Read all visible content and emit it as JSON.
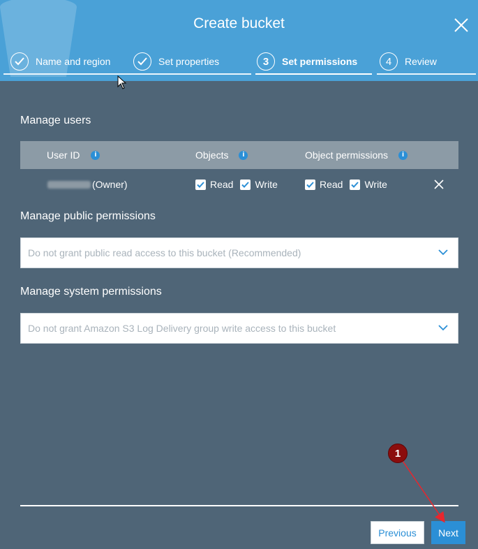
{
  "dialog": {
    "title": "Create bucket",
    "steps": [
      {
        "number": "1",
        "label": "Name and region",
        "state": "completed"
      },
      {
        "number": "2",
        "label": "Set properties",
        "state": "completed"
      },
      {
        "number": "3",
        "label": "Set permissions",
        "state": "active"
      },
      {
        "number": "4",
        "label": "Review",
        "state": "pending"
      }
    ]
  },
  "manage_users": {
    "title": "Manage users",
    "columns": {
      "user_id": "User ID",
      "objects": "Objects",
      "object_permissions": "Object permissions"
    },
    "rows": [
      {
        "user_suffix": "(Owner)",
        "objects_read_label": "Read",
        "objects_read_checked": true,
        "objects_write_label": "Write",
        "objects_write_checked": true,
        "perm_read_label": "Read",
        "perm_read_checked": true,
        "perm_write_label": "Write",
        "perm_write_checked": true
      }
    ]
  },
  "public_permissions": {
    "title": "Manage public permissions",
    "selected": "Do not grant public read access to this bucket (Recommended)"
  },
  "system_permissions": {
    "title": "Manage system permissions",
    "selected": "Do not grant Amazon S3 Log Delivery group write access to this bucket"
  },
  "footer": {
    "previous_label": "Previous",
    "next_label": "Next"
  },
  "annotation": {
    "badge_number": "1",
    "color": "#8b0d0d",
    "arrow_color": "#e8262d"
  },
  "colors": {
    "header_bg": "#4aa1d7",
    "body_bg": "#4f6577",
    "accent": "#2b8fd6",
    "table_head_bg": "#8c9ba6"
  }
}
